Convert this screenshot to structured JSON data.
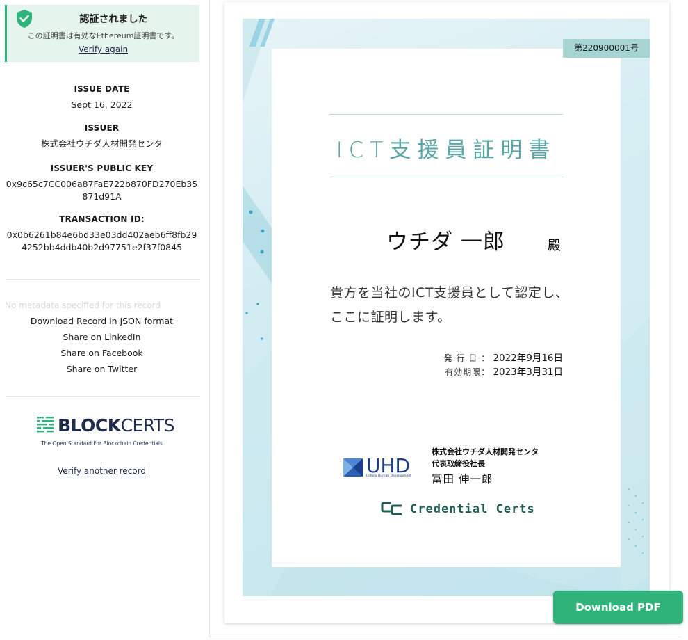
{
  "status": {
    "title": "認証されました",
    "description": "この証明書は有効なEthereum証明書です。",
    "verify_again": "Verify again",
    "color": "#2fb37a"
  },
  "metadata": {
    "issue_date_label": "ISSUE DATE",
    "issue_date": "Sept 16, 2022",
    "issuer_label": "ISSUER",
    "issuer": "株式会社ウチダ人材開発センタ",
    "public_key_label": "ISSUER'S PUBLIC KEY",
    "public_key_line1": "0x9c65c7CC006a87FaE722b870FD270Eb35",
    "public_key_line2": "871d91A",
    "transaction_label": "TRANSACTION ID:",
    "transaction_line1": "0x0b6261b84e6bd33e03dd402aeb6ff8fb29",
    "transaction_line2": "4252bb4ddb40b2d97751e2f37f0845"
  },
  "actions": {
    "no_metadata": "No metadata specified for this record",
    "download_json": "Download Record in JSON format",
    "share_linkedin": "Share on LinkedIn",
    "share_facebook": "Share on Facebook",
    "share_twitter": "Share on Twitter"
  },
  "blockcerts": {
    "name_bold": "BLOCK",
    "name_light": "CERTS",
    "tagline": "The Open Standard For Blockchain Credentials",
    "verify_another": "Verify another record"
  },
  "certificate": {
    "number": "第220900001号",
    "title": "ICT支援員証明書",
    "recipient": "ウチダ 一郎",
    "honorific": "殿",
    "body_line1": "貴方を当社のICT支援員として認定し、",
    "body_line2": "ここに証明します。",
    "issue_label": "発 行 日 ：",
    "issue_value": "2022年9月16日",
    "expiry_label": "有効期限：",
    "expiry_value": "2023年3月31日",
    "company": "株式会社ウチダ人材開発センタ",
    "position": "代表取締役社長",
    "ceo": "冨田 伸一郎",
    "uhd_logo": "UHD",
    "uhd_sub": "Uchida Human Development",
    "credential_certs": "Credential Certs"
  },
  "download_pdf": "Download PDF"
}
